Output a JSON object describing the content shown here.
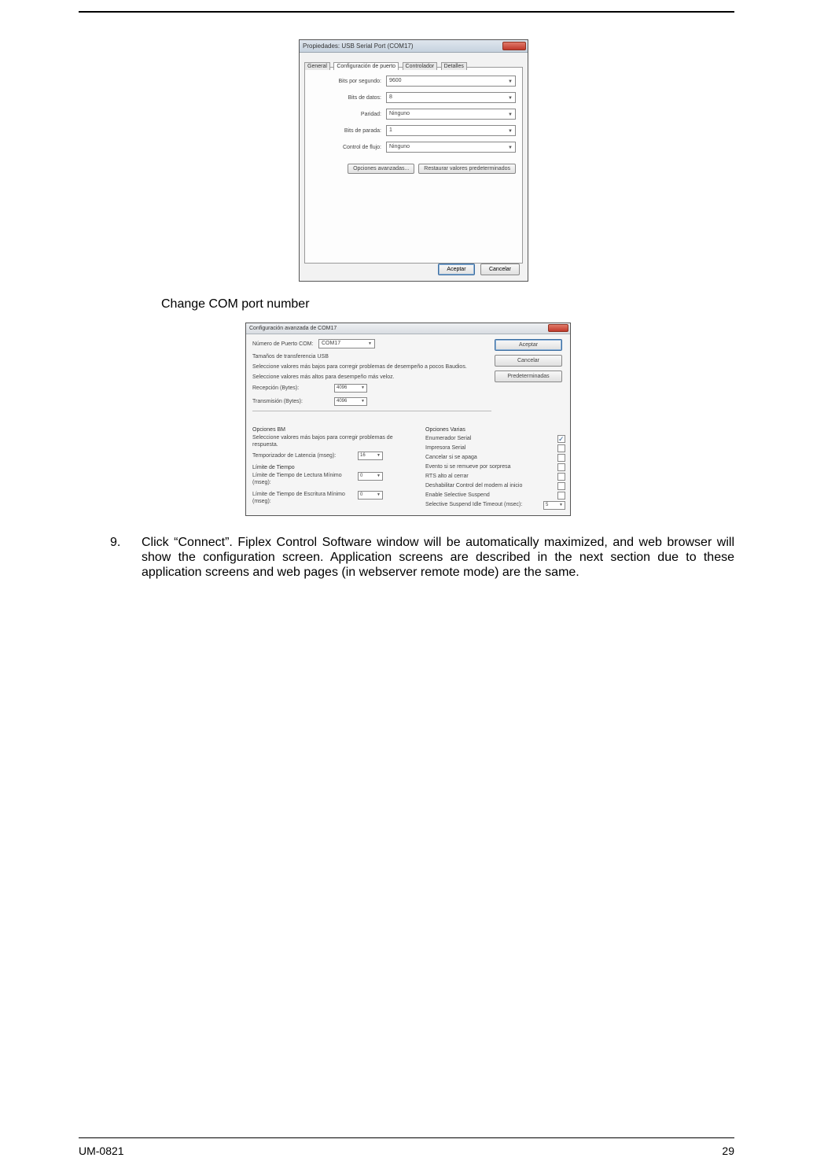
{
  "dlg1": {
    "title": "Propiedades: USB Serial Port (COM17)",
    "tabs": [
      "General",
      "Configuración de puerto",
      "Controlador",
      "Detalles"
    ],
    "tab_active_index": 1,
    "fields": {
      "baud_lbl": "Bits por segundo:",
      "baud_val": "9600",
      "data_lbl": "Bits de datos:",
      "data_val": "8",
      "parity_lbl": "Paridad:",
      "parity_val": "Ninguno",
      "stop_lbl": "Bits de parada:",
      "stop_val": "1",
      "flow_lbl": "Control de flujo:",
      "flow_val": "Ninguno"
    },
    "adv_btn": "Opciones avanzadas...",
    "restore_btn": "Restaurar valores predeterminados",
    "ok_btn": "Aceptar",
    "cancel_btn": "Cancelar"
  },
  "caption": "Change COM port number",
  "dlg2": {
    "title": "Configuración avanzada de COM17",
    "ok_btn": "Aceptar",
    "cancel_btn": "Cancelar",
    "defaults_btn": "Predeterminadas",
    "com_lbl": "Número de Puerto COM:",
    "com_val": "COM17",
    "usb_head": "Tamaños de transferencia USB",
    "usb_line1": "Seleccione valores más bajos para corregir problemas de desempeño a pocos Baudios.",
    "usb_line2": "Seleccione valores más altos para desempeño más veloz.",
    "rx_lbl": "Recepción (Bytes):",
    "rx_val": "4096",
    "tx_lbl": "Transmisión (Bytes):",
    "tx_val": "4096",
    "bm_head": "Opciones BM",
    "bm_line": "Seleccione valores más bajos para corregir problemas de respuesta.",
    "lat_lbl": "Temporizador de Latencia (mseg):",
    "lat_val": "16",
    "to_head": "Límite de Tiempo",
    "rd_to_lbl": "Límite de Tiempo de Lectura Mínimo (mseg):",
    "rd_to_val": "0",
    "wr_to_lbl": "Límite de Tiempo de Escritura Mínimo (mseg):",
    "wr_to_val": "0",
    "misc_head": "Opciones Varias",
    "opt1": "Enumerador Serial",
    "opt2": "Impresora Serial",
    "opt3": "Cancelar si se apaga",
    "opt4": "Evento si se remueve por sorpresa",
    "opt5": "RTS alto al cerrar",
    "opt6": "Deshabilitar Control del modem al inicio",
    "opt7": "Enable Selective Suspend",
    "ss_lbl": "Selective Suspend Idle Timeout (msec):",
    "ss_val": "5"
  },
  "para": {
    "num": "9.",
    "text": "Click “Connect”.  Fiplex Control Software window will be automatically maximized, and web browser will show the configuration screen. Application screens are described in the next section due to these application screens and web pages (in webserver remote mode) are the same."
  },
  "footer": {
    "left": "UM-0821",
    "right": "29"
  }
}
